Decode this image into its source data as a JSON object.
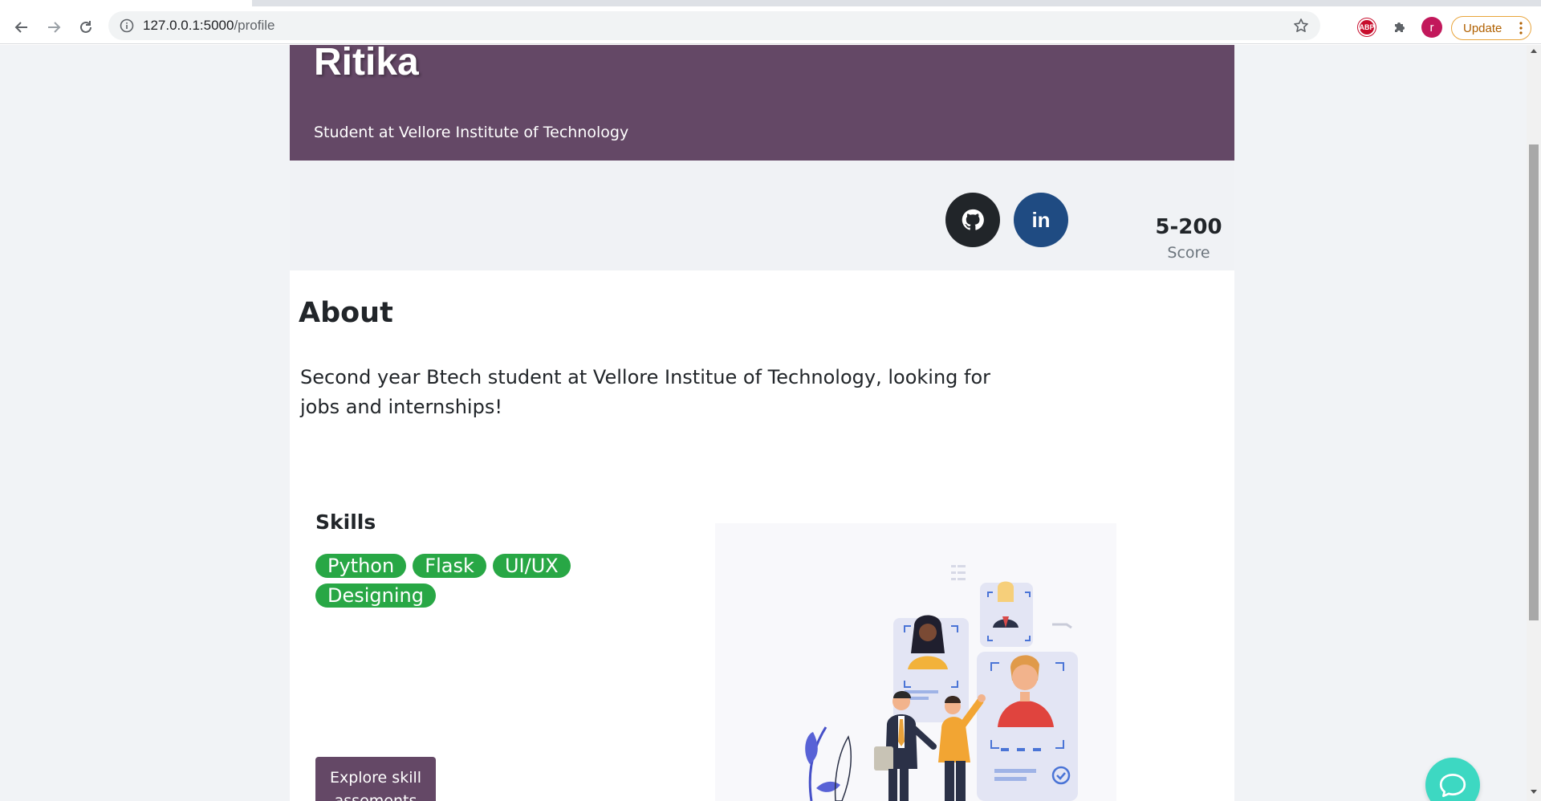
{
  "browser": {
    "url_host": "127.0.0.1:5000",
    "url_path": "/profile",
    "abp_label": "ABP",
    "profile_initial": "r",
    "update_label": "Update"
  },
  "profile": {
    "name": "Ritika",
    "tagline": "Student at Vellore Institute of Technology",
    "linkedin_glyph": "in",
    "score_value": "5-200",
    "score_label": "Score"
  },
  "about": {
    "heading": "About",
    "text": "Second year Btech student at Vellore Institue of Technology, looking for jobs and internships!"
  },
  "skills": {
    "heading": "Skills",
    "items": [
      "Python",
      "Flask",
      "UI/UX Designing"
    ],
    "button_label": "Explore skill assements"
  },
  "colors": {
    "brand": "#644866",
    "skill_badge": "#28a745",
    "github": "#212529",
    "linkedin": "#1f4b82",
    "chat": "#3dd8c2"
  }
}
